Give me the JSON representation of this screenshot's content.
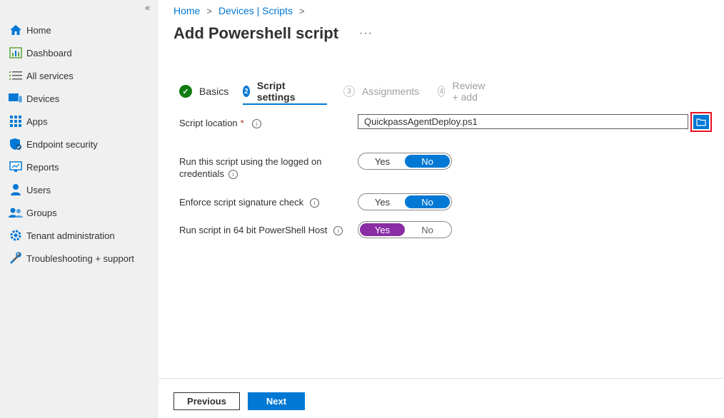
{
  "sidebar": {
    "collapse_glyph": "«",
    "items": [
      {
        "label": "Home",
        "icon": "home-icon"
      },
      {
        "label": "Dashboard",
        "icon": "dashboard-icon"
      },
      {
        "label": "All services",
        "icon": "list-icon"
      },
      {
        "label": "Devices",
        "icon": "devices-icon"
      },
      {
        "label": "Apps",
        "icon": "apps-grid-icon"
      },
      {
        "label": "Endpoint security",
        "icon": "shield-icon"
      },
      {
        "label": "Reports",
        "icon": "reports-icon"
      },
      {
        "label": "Users",
        "icon": "user-icon"
      },
      {
        "label": "Groups",
        "icon": "groups-icon"
      },
      {
        "label": "Tenant administration",
        "icon": "gear-icon"
      },
      {
        "label": "Troubleshooting + support",
        "icon": "tools-icon"
      }
    ]
  },
  "breadcrumb": {
    "items": [
      "Home",
      "Devices | Scripts"
    ],
    "separator": ">"
  },
  "page": {
    "title": "Add Powershell script",
    "more": "···"
  },
  "wizard": {
    "steps": [
      {
        "number": "✓",
        "label": "Basics",
        "state": "complete"
      },
      {
        "number": "2",
        "label": "Script settings",
        "state": "active"
      },
      {
        "number": "3",
        "label": "Assignments",
        "state": "pending"
      },
      {
        "number": "4",
        "label": "Review + add",
        "state": "pending"
      }
    ]
  },
  "form": {
    "script_location": {
      "label": "Script location",
      "required_mark": "*",
      "info": "i",
      "value": "QuickpassAgentDeploy.ps1"
    },
    "run_logged_on": {
      "label_line1": "Run this script using the logged on",
      "label_line2": "credentials",
      "info": "i",
      "options": [
        "Yes",
        "No"
      ],
      "selected": "No"
    },
    "signature_check": {
      "label": "Enforce script signature check",
      "info": "i",
      "options": [
        "Yes",
        "No"
      ],
      "selected": "No"
    },
    "run_64bit": {
      "label": "Run script in 64 bit PowerShell Host",
      "info": "i",
      "options": [
        "Yes",
        "No"
      ],
      "selected": "Yes"
    }
  },
  "footer": {
    "previous": "Previous",
    "next": "Next"
  },
  "colors": {
    "accent": "#0078d4",
    "purple_toggle": "#8a2da5",
    "success": "#107c10",
    "highlight_border": "#e81123"
  }
}
